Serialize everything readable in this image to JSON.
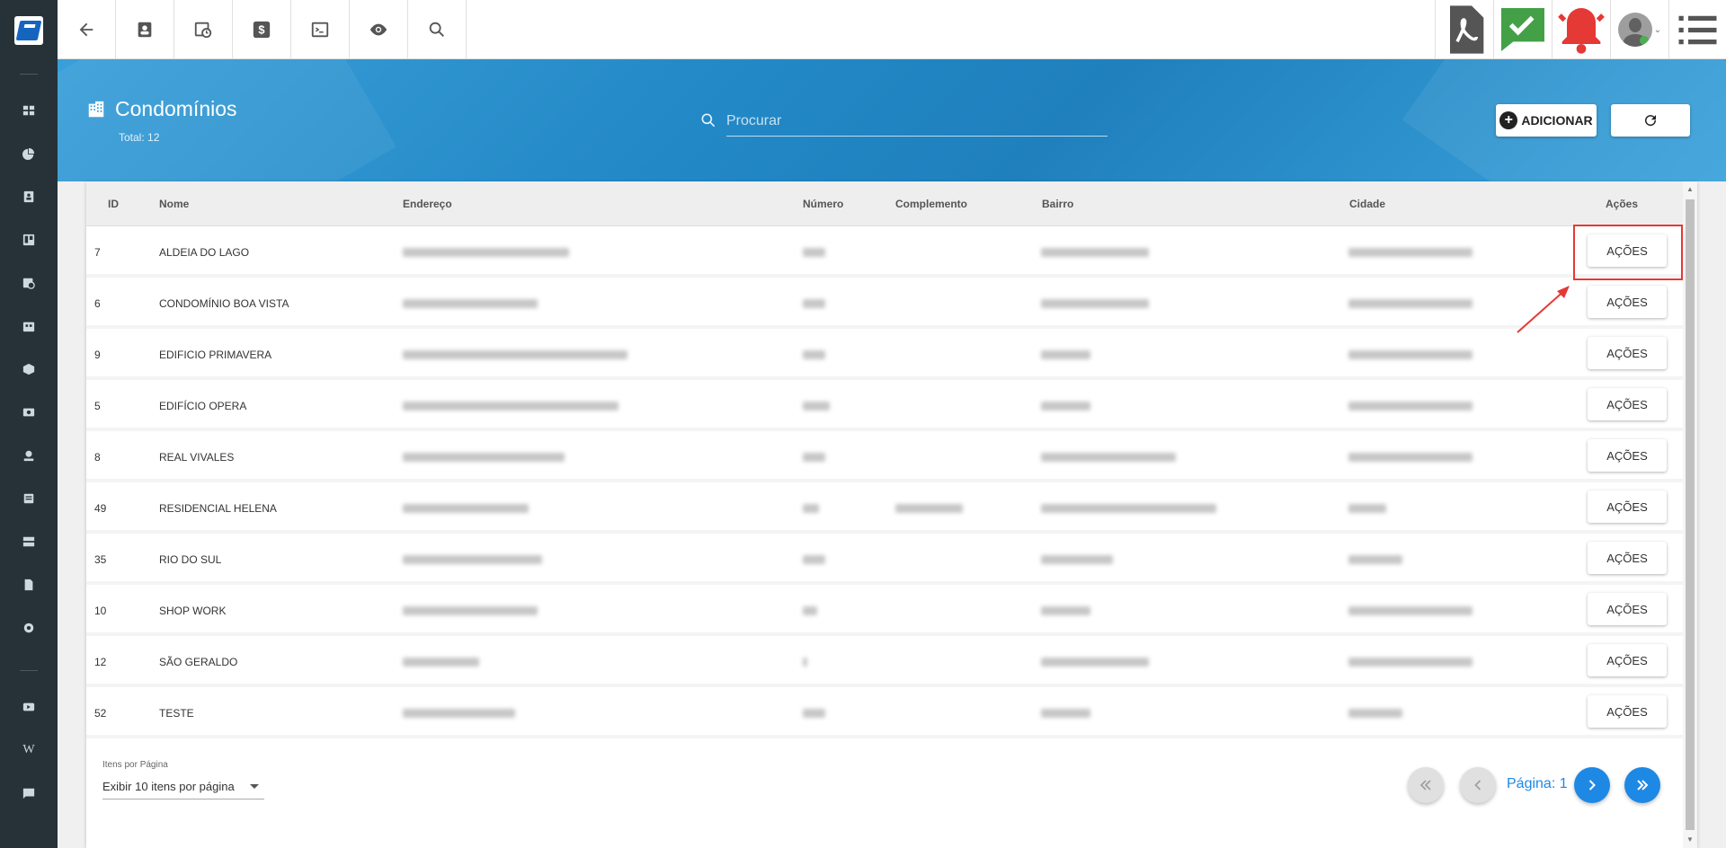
{
  "topbar": {
    "icons": [
      "back-arrow-icon",
      "contact-card-icon",
      "calendar-clock-icon",
      "dollar-icon",
      "terminal-icon",
      "eye-icon",
      "search-icon"
    ],
    "right_icons": [
      "pdf-icon",
      "check-chat-icon",
      "alarm-bell-icon",
      "user-avatar",
      "menu-list-icon"
    ]
  },
  "header": {
    "title": "Condomínios",
    "total": "Total: 12",
    "search_placeholder": "Procurar",
    "add_label": "ADICIONAR"
  },
  "table": {
    "columns": [
      "ID",
      "Nome",
      "Endereço",
      "Número",
      "Complemento",
      "Bairro",
      "Cidade",
      "Ações"
    ],
    "action_label": "AÇÕES",
    "rows": [
      {
        "id": "7",
        "nome": "ALDEIA DO LAGO"
      },
      {
        "id": "6",
        "nome": "CONDOMÍNIO BOA VISTA"
      },
      {
        "id": "9",
        "nome": "EDIFICIO PRIMAVERA"
      },
      {
        "id": "5",
        "nome": "EDIFÍCIO OPERA"
      },
      {
        "id": "8",
        "nome": "REAL VIVALES"
      },
      {
        "id": "49",
        "nome": "RESIDENCIAL HELENA"
      },
      {
        "id": "35",
        "nome": "RIO DO SUL"
      },
      {
        "id": "10",
        "nome": "SHOP WORK"
      },
      {
        "id": "12",
        "nome": "SÃO GERALDO"
      },
      {
        "id": "52",
        "nome": "TESTE"
      }
    ]
  },
  "footer": {
    "per_page_label": "Itens por Página",
    "per_page_value": "Exibir 10 itens por página",
    "page_label": "Página: 1"
  },
  "colors": {
    "header_blue": "#2288c6",
    "sidebar": "#263238",
    "pagination_active": "#1e88e5",
    "highlight": "#e53935"
  }
}
